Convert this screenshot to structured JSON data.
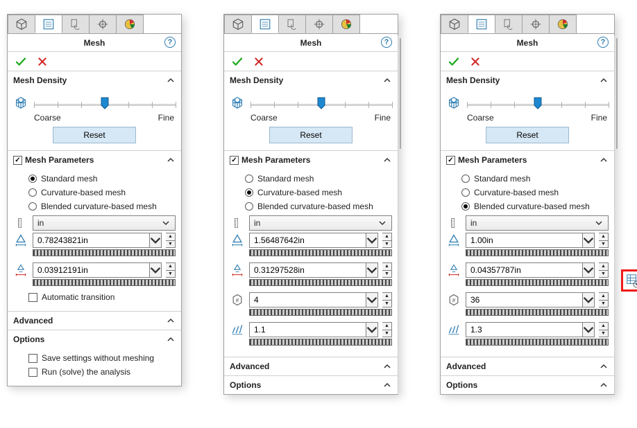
{
  "common": {
    "title": "Mesh",
    "density": {
      "label": "Mesh Density",
      "coarse": "Coarse",
      "fine": "Fine",
      "reset": "Reset"
    },
    "params_label": "Mesh Parameters",
    "radios": {
      "standard": "Standard mesh",
      "curvature": "Curvature-based mesh",
      "blended": "Blended curvature-based mesh"
    },
    "unit": "in",
    "auto_transition": "Automatic transition",
    "advanced": "Advanced",
    "options": "Options",
    "save_settings": "Save settings without meshing",
    "run_solve": "Run (solve) the analysis"
  },
  "panels": [
    {
      "mesh_type": "standard",
      "size1": "0.78243821in",
      "size2": "0.03912191in",
      "show_auto_transition": true,
      "show_options_body": true,
      "scrollbar": false
    },
    {
      "mesh_type": "curvature",
      "size1": "1.56487642in",
      "size2": "0.31297528in",
      "extra1": "4",
      "extra2": "1.1",
      "show_auto_transition": false,
      "show_options_body": false,
      "scrollbar": true
    },
    {
      "mesh_type": "blended",
      "size1": "1.00in",
      "size2": "0.04357787in",
      "extra1": "36",
      "extra2": "1.3",
      "show_auto_transition": false,
      "show_options_body": false,
      "scrollbar": true,
      "highlight_side_button": true
    }
  ]
}
